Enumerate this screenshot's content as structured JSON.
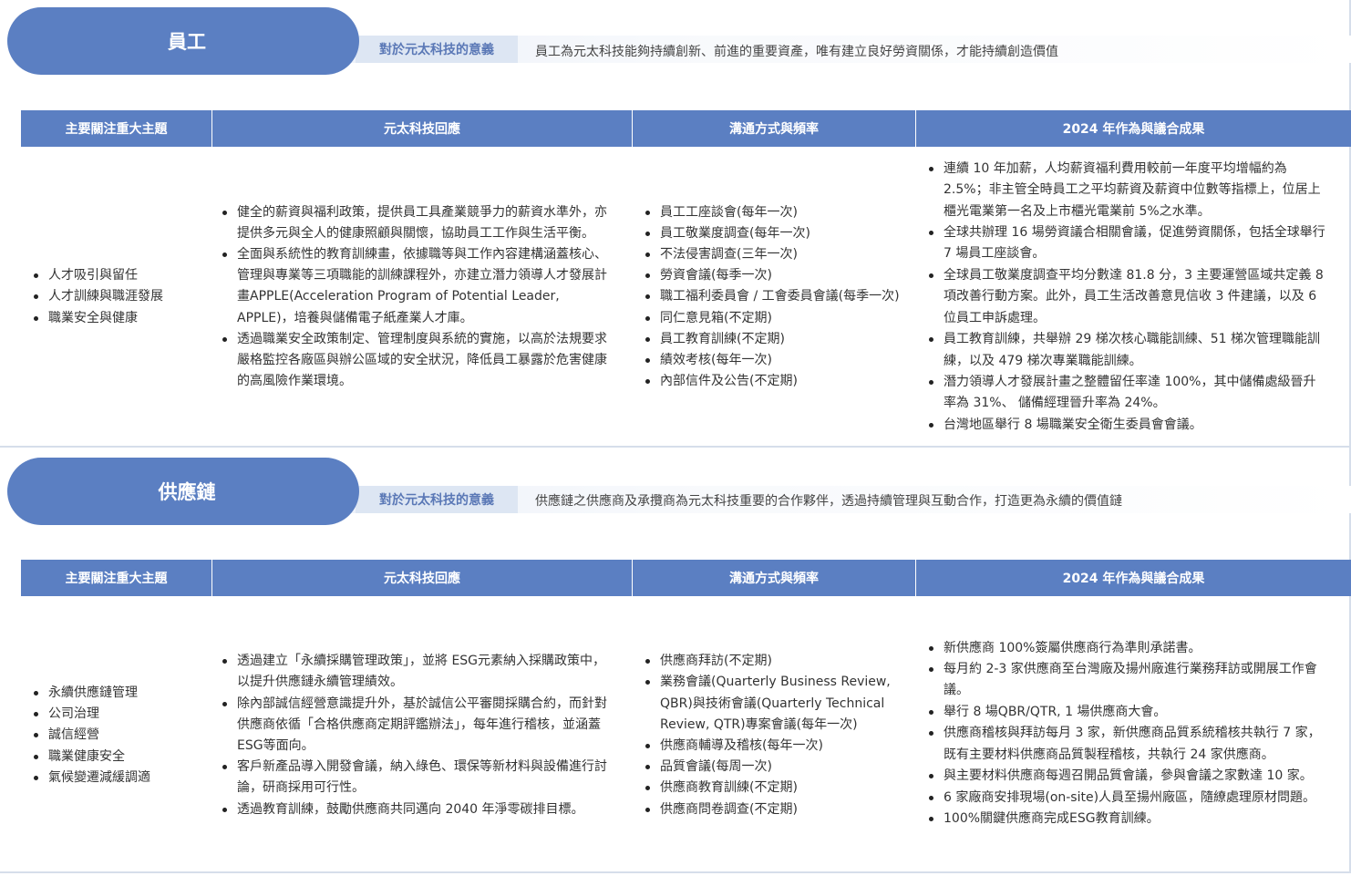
{
  "sections": [
    {
      "name": "員工",
      "significance_label": "對於元太科技的意義",
      "significance_text": "員工為元太科技能夠持續創新、前進的重要資產，唯有建立良好勞資關係，才能持續創造價值",
      "headers": [
        "主要關注重大主題",
        "元太科技回應",
        "溝通方式與頻率",
        "2024 年作為與議合成果"
      ],
      "topics": [
        "人才吸引與留任",
        "人才訓練與職涯發展",
        "職業安全與健康"
      ],
      "responses": [
        "健全的薪資與福利政策，提供員工具產業競爭力的薪資水準外，亦提供多元與全人的健康照顧與關懷，協助員工工作與生活平衡。",
        "全面與系統性的教育訓練畫，依據職等與工作內容建構涵蓋核心、管理與專業等三項職能的訓練課程外，亦建立潛力領導人才發展計畫APPLE(Acceleration Program of Potential Leader, APPLE)，培養與儲備電子紙產業人才庫。",
        "透過職業安全政策制定、管理制度與系統的實施，以高於法規要求嚴格監控各廠區與辦公區域的安全狀況，降低員工暴露於危害健康的高風險作業環境。"
      ],
      "channels": [
        "員工工座談會(每年一次)",
        "員工敬業度調查(每年一次)",
        "不法侵害調查(三年一次)",
        "勞資會議(每季一次)",
        "職工福利委員會 / 工會委員會議(每季一次)",
        "同仁意見箱(不定期)",
        "員工教育訓練(不定期)",
        "績效考核(每年一次)",
        "內部信件及公告(不定期)"
      ],
      "results": [
        "連續 10 年加薪，人均薪資福利費用較前一年度平均增幅約為 2.5%；非主管全時員工之平均薪資及薪資中位數等指標上，位居上櫃光電業第一名及上市櫃光電業前 5%之水準。",
        "全球共辦理 16 場勞資議合相關會議，促進勞資關係，包括全球舉行 7 場員工座談會。",
        "全球員工敬業度調查平均分數達 81.8 分，3 主要運營區域共定義 8 項改善行動方案。此外，員工生活改善意見信收 3 件建議，以及 6 位員工申訴處理。",
        "員工教育訓練，共舉辦 29 梯次核心職能訓練、51 梯次管理職能訓練，以及 479 梯次專業職能訓練。",
        "潛力領導人才發展計畫之整體留任率達 100%，其中儲備處級晉升率為 31%、 儲備經理晉升率為 24%。",
        "台灣地區舉行 8 場職業安全衛生委員會會議。"
      ]
    },
    {
      "name": "供應鏈",
      "significance_label": "對於元太科技的意義",
      "significance_text": "供應鏈之供應商及承攬商為元太科技重要的合作夥伴，透過持續管理與互動合作，打造更為永續的價值鏈",
      "headers": [
        "主要關注重大主題",
        "元太科技回應",
        "溝通方式與頻率",
        "2024 年作為與議合成果"
      ],
      "topics": [
        "永續供應鏈管理",
        "公司治理",
        "誠信經營",
        "職業健康安全",
        "氣候變遷減緩調適"
      ],
      "responses": [
        "透過建立「永續採購管理政策」，並將 ESG元素納入採購政策中，以提升供應鏈永續管理績效。",
        "除內部誠信經營意識提升外，基於誠信公平審閱採購合約，而針對供應商依循「合格供應商定期評鑑辦法」，每年進行稽核，並涵蓋ESG等面向。",
        "客戶新產品導入開發會議，納入綠色、環保等新材料與設備進行討論，研商採用可行性。",
        "透過教育訓練，鼓勵供應商共同邁向 2040 年淨零碳排目標。"
      ],
      "channels": [
        "供應商拜訪(不定期)",
        "業務會議(Quarterly Business Review, QBR)與技術會議(Quarterly Technical Review, QTR)專案會議(每年一次)",
        "供應商輔導及稽核(每年一次)",
        "品質會議(每周一次)",
        "供應商教育訓練(不定期)",
        "供應商問卷調查(不定期)"
      ],
      "results": [
        "新供應商 100%簽屬供應商行為準則承諾書。",
        "每月約 2-3 家供應商至台灣廠及揚州廠進行業務拜訪或開展工作會議。",
        "舉行 8 場QBR/QTR, 1 場供應商大會。",
        "供應商稽核與拜訪每月 3 家，新供應商品質系統稽核共執行 7 家，既有主要材料供應商品質製程稽核，共執行 24 家供應商。",
        "與主要材料供應商每週召開品質會議，參與會議之家數達 10 家。",
        "6 家廠商安排現場(on-site)人員至揚州廠區，隨繚處理原材問題。",
        "100%關鍵供應商完成ESG教育訓練。"
      ]
    }
  ]
}
